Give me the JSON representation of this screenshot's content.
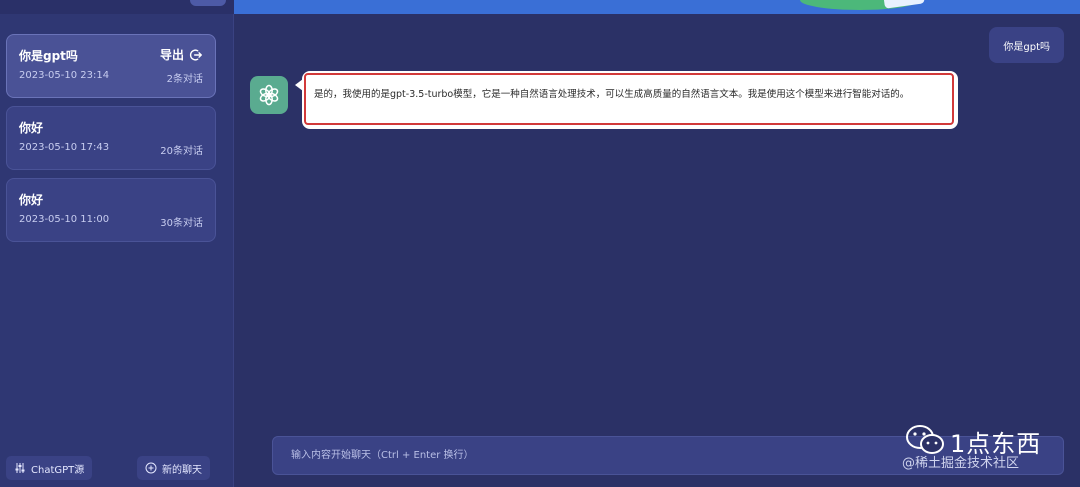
{
  "sidebar": {
    "sessions": [
      {
        "title": "你是gpt吗",
        "date": "2023-05-10 23:14",
        "count": "2条对话",
        "active": true
      },
      {
        "title": "你好",
        "date": "2023-05-10 17:43",
        "count": "20条对话",
        "active": false
      },
      {
        "title": "你好",
        "date": "2023-05-10 11:00",
        "count": "30条对话",
        "active": false
      }
    ],
    "export_label": "导出",
    "footer": {
      "source_label": "ChatGPT源",
      "new_chat_label": "新的聊天"
    }
  },
  "chat": {
    "user_message": "你是gpt吗",
    "bot_message": "是的，我使用的是gpt-3.5-turbo模型，它是一种自然语言处理技术，可以生成高质量的自然语言文本。我是使用这个模型来进行智能对话的。",
    "bot_avatar_icon": "openai-logo-icon"
  },
  "input": {
    "placeholder": "输入内容开始聊天（Ctrl + Enter 换行）",
    "value": ""
  },
  "watermark": {
    "brand": "1点东西",
    "sub": "@稀土掘金技术社区"
  },
  "colors": {
    "background": "#2b3166",
    "sidebar": "#2f3773",
    "card": "#3a4285",
    "active_card": "#4a5296",
    "banner": "#3a6fd6",
    "bot_avatar": "#5aab90",
    "highlight": "#d23a3a"
  }
}
